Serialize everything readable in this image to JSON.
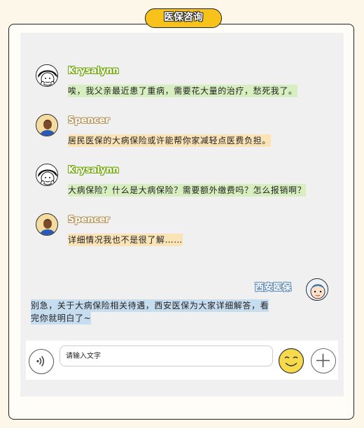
{
  "header": {
    "title": "医保咨询"
  },
  "messages": [
    {
      "sender": "Krysalynn",
      "text": "唉，我父亲最近患了重病，需要花大量的治疗，愁死我了。"
    },
    {
      "sender": "Spencer",
      "text": "居民医保的大病保险或许能帮你家减轻点医费负担。"
    },
    {
      "sender": "Krysalynn",
      "text": "大病保险？什么是大病保险？需要额外缴费吗？怎么报销啊？"
    },
    {
      "sender": "Spencer",
      "text": "详细情况我也不是很了解……"
    },
    {
      "sender": "西安医保",
      "line1": "别急，关于大病保险相关待遇，西安医保为大家详细解答，看",
      "line2": "完你就明白了~"
    }
  ],
  "input": {
    "placeholder": "请输入文字"
  },
  "icons": {
    "voice": "voice-icon",
    "emoji": "smiley-icon",
    "plus": "plus-icon"
  },
  "colors": {
    "title_pill": "#f7c21a",
    "krysalynn_bubble": "#d7efc0",
    "spencer_bubble": "#fbe3b8",
    "official_bubble": "#c6dcef"
  }
}
